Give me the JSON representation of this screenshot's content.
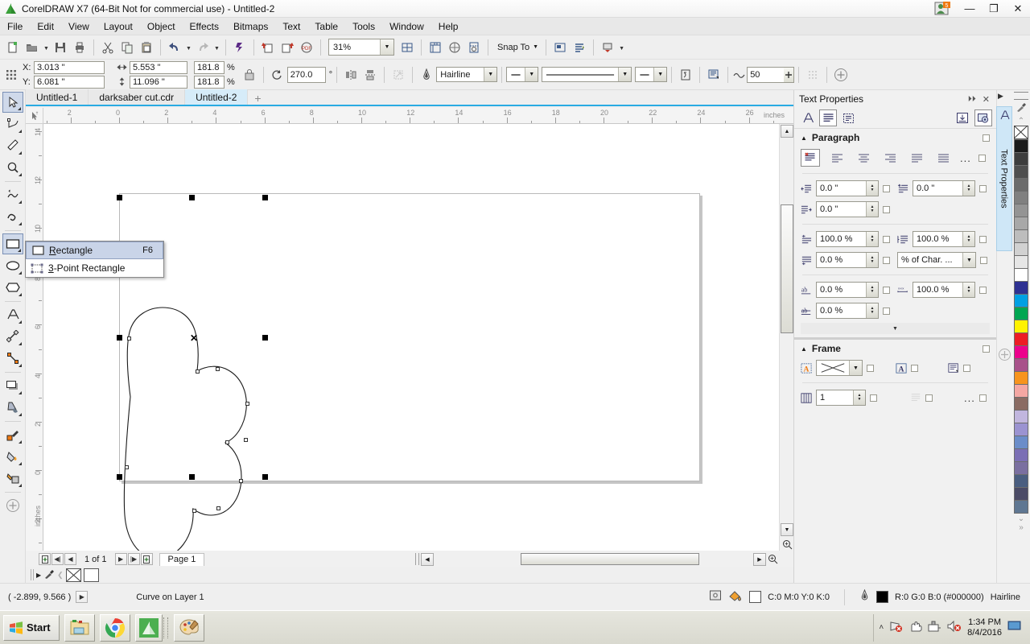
{
  "window": {
    "title": "CorelDRAW X7 (64-Bit Not for commercial use) - Untitled-2",
    "logo_icon": "coreldraw-logo-icon",
    "minimize_label": "—",
    "restore_label": "❐",
    "close_label": "✕"
  },
  "menubar": {
    "items": [
      {
        "label": "File"
      },
      {
        "label": "Edit"
      },
      {
        "label": "View"
      },
      {
        "label": "Layout"
      },
      {
        "label": "Object"
      },
      {
        "label": "Effects"
      },
      {
        "label": "Bitmaps"
      },
      {
        "label": "Text"
      },
      {
        "label": "Table"
      },
      {
        "label": "Tools"
      },
      {
        "label": "Window"
      },
      {
        "label": "Help"
      }
    ]
  },
  "standard_toolbar": {
    "zoom_level": "31%",
    "snap_to_label": "Snap To",
    "buttons": [
      {
        "name": "new-document-button",
        "icon": "new-doc-icon"
      },
      {
        "name": "open-document-button",
        "icon": "open-folder-icon"
      },
      {
        "name": "save-button",
        "icon": "save-disk-icon"
      },
      {
        "name": "print-button",
        "icon": "printer-icon"
      },
      {
        "name": "cut-button",
        "icon": "scissors-icon"
      },
      {
        "name": "copy-button",
        "icon": "copy-icon"
      },
      {
        "name": "paste-button",
        "icon": "paste-icon"
      },
      {
        "name": "undo-button",
        "icon": "undo-arrow-icon"
      },
      {
        "name": "redo-button",
        "icon": "redo-arrow-icon"
      },
      {
        "name": "search-content-button",
        "icon": "corel-connect-icon"
      },
      {
        "name": "import-button",
        "icon": "import-icon"
      },
      {
        "name": "export-button",
        "icon": "export-icon"
      },
      {
        "name": "publish-pdf-button",
        "icon": "pdf-icon"
      },
      {
        "name": "zoom-levels-combo",
        "icon": "zoom-combo-icon"
      },
      {
        "name": "full-screen-preview-button",
        "icon": "fullscreen-icon"
      },
      {
        "name": "show-rulers-button",
        "icon": "ruler-icon"
      },
      {
        "name": "show-grid-button",
        "icon": "grid-icon"
      },
      {
        "name": "show-guidelines-button",
        "icon": "guidelines-icon"
      },
      {
        "name": "options-button",
        "icon": "options-icon"
      },
      {
        "name": "application-launcher-button",
        "icon": "launcher-icon"
      }
    ]
  },
  "property_bar": {
    "x_label": "X:",
    "y_label": "Y:",
    "x_value": "3.013 \"",
    "y_value": "6.081 \"",
    "width_value": "5.553 \"",
    "height_value": "11.096 \"",
    "scale_h": "181.8",
    "scale_v": "181.8",
    "percent_symbol": "%",
    "rotation_value": "270.0",
    "degree_symbol": "°",
    "outline_width": "Hairline",
    "outline_style_value": "",
    "outline_arrow_start": "",
    "outline_arrow_end": "",
    "wrap_value": "50",
    "lock_ratio_icon": "lock-closed-icon",
    "mirror_h_icon": "mirror-horizontal-icon",
    "mirror_v_icon": "mirror-vertical-icon"
  },
  "document_tabs": {
    "tabs": [
      {
        "label": "Untitled-1",
        "active": false
      },
      {
        "label": "darksaber cut.cdr",
        "active": false
      },
      {
        "label": "Untitled-2",
        "active": true
      }
    ],
    "new_tab_label": "+"
  },
  "toolbox": {
    "tools": [
      {
        "name": "pick-tool",
        "icon": "arrow-cursor-icon",
        "selected": true
      },
      {
        "name": "shape-tool",
        "icon": "node-edit-icon",
        "selected": false
      },
      {
        "name": "crop-tool",
        "icon": "crop-knife-icon",
        "selected": false
      },
      {
        "name": "zoom-tool",
        "icon": "magnifier-icon",
        "selected": false
      },
      {
        "name": "freehand-tool",
        "icon": "freehand-curve-icon",
        "selected": false
      },
      {
        "name": "smart-fill-tool",
        "icon": "smart-drawing-icon",
        "selected": false
      },
      {
        "name": "rectangle-tool",
        "icon": "rectangle-icon",
        "selected": true
      },
      {
        "name": "ellipse-tool",
        "icon": "ellipse-icon",
        "selected": false
      },
      {
        "name": "polygon-tool",
        "icon": "polygon-icon",
        "selected": false
      },
      {
        "name": "text-tool",
        "icon": "letter-a-icon",
        "selected": false
      },
      {
        "name": "parallel-dimension-tool",
        "icon": "dimension-icon",
        "selected": false
      },
      {
        "name": "straight-line-connector-tool",
        "icon": "connector-icon",
        "selected": false
      },
      {
        "name": "drop-shadow-tool",
        "icon": "drop-shadow-icon",
        "selected": false
      },
      {
        "name": "transparency-tool",
        "icon": "transparency-icon",
        "selected": false
      },
      {
        "name": "color-eyedropper-tool",
        "icon": "eyedropper-icon",
        "selected": false
      },
      {
        "name": "interactive-fill-tool",
        "icon": "fill-bucket-icon",
        "selected": false
      },
      {
        "name": "smart-fill-bucket-tool",
        "icon": "smart-fill-icon",
        "selected": false
      },
      {
        "name": "quick-customize-button",
        "icon": "plus-circle-icon",
        "selected": false
      }
    ]
  },
  "flyout": {
    "items": [
      {
        "label": "Rectangle",
        "underline": "R",
        "shortcut": "F6",
        "icon": "rectangle-icon",
        "selected": true
      },
      {
        "label": "3-Point Rectangle",
        "underline": "3",
        "shortcut": "",
        "icon": "three-point-rectangle-icon",
        "selected": false
      }
    ]
  },
  "rulers": {
    "unit_label": "inches",
    "h_labels": [
      "2",
      "0",
      "2",
      "4",
      "6",
      "8",
      "10",
      "12",
      "14",
      "16",
      "18",
      "20",
      "22",
      "24",
      "26"
    ],
    "v_labels": [
      "14",
      "12",
      "10",
      "8",
      "6",
      "4",
      "2",
      "0",
      "2"
    ],
    "v_unit_label": "inches"
  },
  "canvas": {
    "selected_object": "cloud-shape-curve",
    "center_marker": "✕",
    "selection_handles": 8
  },
  "page_nav": {
    "first_page_icon": "first-page-icon",
    "prev_page_icon": "prev-page-icon",
    "page_count_label": "1 of 1",
    "next_page_icon": "next-page-icon",
    "last_page_icon": "last-page-icon",
    "add_page_icon": "add-page-icon",
    "page_tab_label": "Page 1"
  },
  "status_bar": {
    "coordinates": "( -2.899, 9.566 )",
    "object_info": "Curve on Layer 1",
    "fill_label": "C:0 M:0 Y:0 K:0",
    "outline_label": "R:0 G:0 B:0 (#000000)",
    "outline_width_label": "Hairline",
    "fill_swatch_color": "#ffffff",
    "outline_swatch_color": "#000000"
  },
  "docker": {
    "title": "Text Properties",
    "vertical_tab_label": "Text Properties",
    "tabs": [
      {
        "name": "character-tab",
        "icon": "letter-a-outline-icon",
        "selected": false
      },
      {
        "name": "paragraph-tab",
        "icon": "paragraph-lines-icon",
        "selected": true
      },
      {
        "name": "frame-tab",
        "icon": "text-frame-icon",
        "selected": false
      }
    ],
    "header_buttons": [
      {
        "name": "collapse-docker-button",
        "icon": "double-chevron-right-icon",
        "label": "⏵⏵"
      },
      {
        "name": "close-docker-button",
        "icon": "close-icon",
        "label": "✕"
      }
    ],
    "paragraph": {
      "section_label": "Paragraph",
      "alignment_buttons": [
        {
          "name": "align-none-button",
          "icon": "align-none-icon",
          "selected": true
        },
        {
          "name": "align-left-button",
          "icon": "align-left-icon",
          "selected": false
        },
        {
          "name": "align-center-button",
          "icon": "align-center-icon",
          "selected": false
        },
        {
          "name": "align-right-button",
          "icon": "align-right-icon",
          "selected": false
        },
        {
          "name": "align-justify-button",
          "icon": "align-justify-icon",
          "selected": false
        },
        {
          "name": "align-force-justify-button",
          "icon": "align-force-justify-icon",
          "selected": false
        }
      ],
      "more_label": "...",
      "left_indent": "0.0 \"",
      "first_line_indent": "0.0 \"",
      "right_indent": "0.0 \"",
      "before_paragraph": "100.0 %",
      "after_paragraph": "100.0 %",
      "line_spacing": "0.0 %",
      "line_spacing_units": "% of Char. ...",
      "character_spacing": "0.0 %",
      "word_spacing": "100.0 %",
      "language_spacing": "0.0 %"
    },
    "frame": {
      "section_label": "Frame",
      "fill_value": "",
      "columns_value": "1",
      "more_label": "...",
      "buttons": [
        {
          "name": "frame-fill-button",
          "icon": "frame-fill-icon"
        },
        {
          "name": "text-wrap-button",
          "icon": "text-wrap-icon"
        },
        {
          "name": "vertical-align-button",
          "icon": "vertical-align-icon"
        },
        {
          "name": "columns-button",
          "icon": "columns-icon"
        },
        {
          "name": "bullet-list-button",
          "icon": "bullet-list-icon"
        }
      ]
    }
  },
  "palette": {
    "tools": [
      {
        "name": "palette-scroll-up-icon",
        "label": "⌃"
      },
      {
        "name": "eyedropper-icon",
        "label": ""
      }
    ],
    "none_label": "✕",
    "colors": [
      "#1a1a1a",
      "#3d3d3d",
      "#4f4f4f",
      "#6b6b6b",
      "#808080",
      "#949494",
      "#a8a8a8",
      "#bdbdbd",
      "#d1d1d1",
      "#e6e6e6",
      "#ffffff",
      "#2e3192",
      "#00a0e3",
      "#00a651",
      "#fff200",
      "#ed1c24",
      "#ec008c",
      "#a8518a",
      "#f7941d",
      "#f4a7a3",
      "#8a6b63",
      "#c1b6de",
      "#9b93d1",
      "#6b8dc9",
      "#7b6fb5",
      "#7a6fa0",
      "#4a5e80",
      "#4b4b66",
      "#5f7792"
    ],
    "scroll_down_label": "⌄",
    "expand_label": "»"
  },
  "taskbar": {
    "start_label": "Start",
    "items": [
      {
        "name": "taskbar-explorer-button",
        "icon": "folder-icon"
      },
      {
        "name": "taskbar-chrome-button",
        "icon": "chrome-icon"
      },
      {
        "name": "taskbar-coreldraw-button",
        "icon": "coreldraw-icon"
      },
      {
        "name": "taskbar-paint-button",
        "icon": "paint-palette-icon"
      }
    ],
    "tray": {
      "expand_label": "˄",
      "icons": [
        {
          "name": "network-error-icon"
        },
        {
          "name": "action-center-icon"
        },
        {
          "name": "safely-remove-icon"
        },
        {
          "name": "volume-muted-icon"
        }
      ],
      "time": "1:34 PM",
      "date": "8/4/2016",
      "show_desktop_icon": "show-desktop-icon"
    }
  }
}
